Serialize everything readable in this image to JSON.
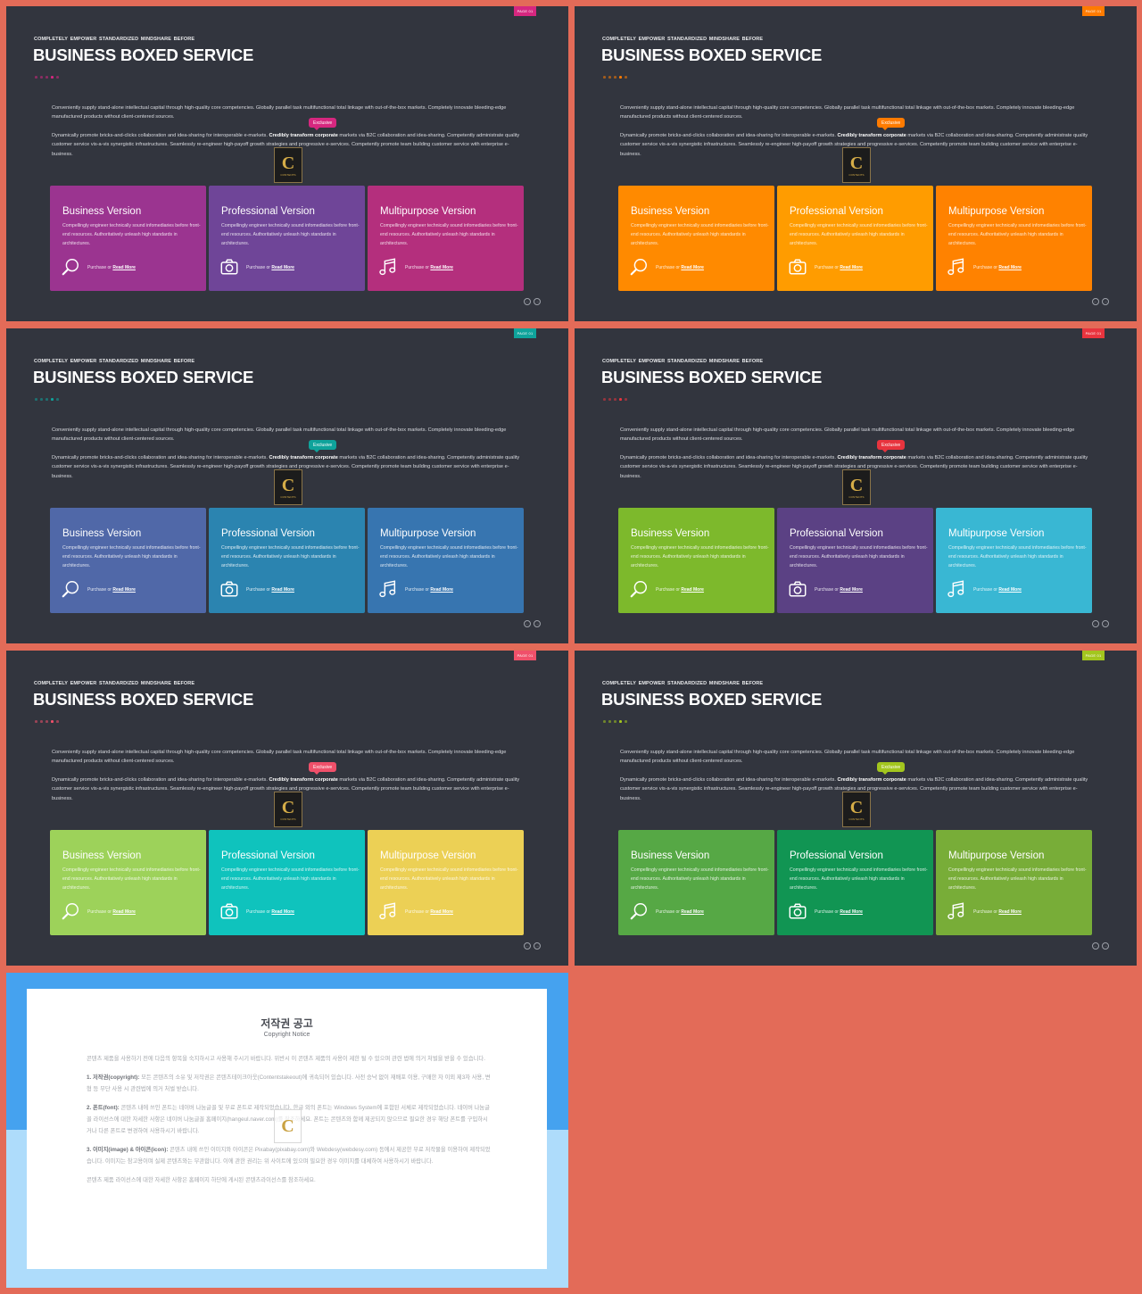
{
  "common": {
    "page_label": "PAGE 01",
    "kicker": "COMPLETELY  EMPOWER  STANDARDIZED  MINDSHARE  BEFORE",
    "title": "BUSINESS BOXED SERVICE",
    "para1": "Conveniently supply stand-alone intellectual capital through high-quality core competencies.  Globally parallel task multifunctional total linkage with out-of-the-box markets.  Completely innovate bleeding-edge manufactured products without client-centered sources.",
    "para2_before": "Dynamically promote bricks-and-clicks collaboration and idea-sharing for interoperable e-markets. ",
    "para2_bold": "Credibly transform corporate",
    "para2_after": " markets via B2C collaboration and idea-sharing. Competently administrate quality customer service vis-a-vis synergistic infrastructures. Seamlessly re-engineer high-payoff growth  strategies and progressive e-services. Competently  promote team building customer service with enterprise e-business.",
    "exclusive_label": "Exclusive",
    "logo_letter": "C",
    "logo_text": "CONTENTS",
    "card_desc": "Compellingly engineer technically sound infomediaries before front-end resources. Authoritatively unleash high standards in architectures.",
    "purchase_text": "Purchase or ",
    "read_more": "Read More",
    "nav_prev": "←",
    "nav_next": "→"
  },
  "slides": [
    {
      "accent": "#d6277f",
      "dots": [
        "#d6277f",
        "#d6277f",
        "#d6277f",
        "#d6277f",
        "#d6277f"
      ],
      "active_dot": 3,
      "cards": [
        {
          "title": "Business Version",
          "icon": "search-icon",
          "color": "#9b3490"
        },
        {
          "title": "Professional Version",
          "icon": "camera-icon",
          "color": "#6f4598"
        },
        {
          "title": "Multipurpose Version",
          "icon": "music-icon",
          "color": "#b42f7d"
        }
      ]
    },
    {
      "accent": "#ff7b00",
      "dots": [
        "#ff7b00",
        "#ff7b00",
        "#ff7b00",
        "#ff7b00",
        "#ff7b00"
      ],
      "active_dot": 3,
      "cards": [
        {
          "title": "Business Version",
          "icon": "search-icon",
          "color": "#ff8a00"
        },
        {
          "title": "Professional Version",
          "icon": "camera-icon",
          "color": "#ff9c00"
        },
        {
          "title": "Multipurpose Version",
          "icon": "music-icon",
          "color": "#ff8200"
        }
      ]
    },
    {
      "accent": "#0fa39b",
      "dots": [
        "#0fa39b",
        "#0fa39b",
        "#0fa39b",
        "#0fa39b",
        "#0fa39b"
      ],
      "active_dot": 3,
      "cards": [
        {
          "title": "Business Version",
          "icon": "search-icon",
          "color": "#5068a8"
        },
        {
          "title": "Professional Version",
          "icon": "camera-icon",
          "color": "#2b84b0"
        },
        {
          "title": "Multipurpose Version",
          "icon": "music-icon",
          "color": "#3775b0"
        }
      ]
    },
    {
      "accent": "#e8343e",
      "dots": [
        "#e8343e",
        "#e8343e",
        "#e8343e",
        "#e8343e",
        "#e8343e"
      ],
      "active_dot": 3,
      "cards": [
        {
          "title": "Business Version",
          "icon": "search-icon",
          "color": "#7db92c"
        },
        {
          "title": "Professional Version",
          "icon": "camera-icon",
          "color": "#5b4184"
        },
        {
          "title": "Multipurpose Version",
          "icon": "music-icon",
          "color": "#39b7d3"
        }
      ]
    },
    {
      "accent": "#f0506a",
      "dots": [
        "#f0506a",
        "#f0506a",
        "#f0506a",
        "#f0506a",
        "#f0506a"
      ],
      "active_dot": 3,
      "cards": [
        {
          "title": "Business Version",
          "icon": "search-icon",
          "color": "#9dd25a"
        },
        {
          "title": "Professional Version",
          "icon": "camera-icon",
          "color": "#0fc3bd"
        },
        {
          "title": "Multipurpose Version",
          "icon": "music-icon",
          "color": "#ecd055"
        }
      ]
    },
    {
      "accent": "#a3c61e",
      "dots": [
        "#a3c61e",
        "#a3c61e",
        "#a3c61e",
        "#a3c61e",
        "#a3c61e"
      ],
      "active_dot": 3,
      "cards": [
        {
          "title": "Business Version",
          "icon": "search-icon",
          "color": "#56a845"
        },
        {
          "title": "Professional Version",
          "icon": "camera-icon",
          "color": "#119553"
        },
        {
          "title": "Multipurpose Version",
          "icon": "music-icon",
          "color": "#78ad38"
        }
      ]
    }
  ],
  "copyright": {
    "title": "저작권 공고",
    "subtitle": "Copyright Notice",
    "intro": "콘텐츠 제품을 사용하기 전에 다음의 항목을 숙지하시고 사용해 주시기 바랍니다. 위반시 이 콘텐츠 제품의 사용이 제한 될 수 있으며 관련 법에 의거 처벌을 받을 수 있습니다.",
    "item1_head": "1. 저작권(copyright):",
    "item1_body": " 모든 콘텐츠의 소유 및 저작권은 콘텐츠테이크아웃(Contentstakeout)에 귀속되어 있습니다. 사전 승낙 없이 재배포 이용, 구매한 자 이외 제3자 사용, 변형 등 무단 사용 시 관련법에 의거 처벌 받습니다.",
    "item2_head": "2. 폰트(font):",
    "item2_body": " 콘텐츠 내에 쓰인 폰트는 네이버 나눔글꼴 및 무료 폰트로 제작되었습니다. 한글 외의 폰트는 Windows System에 포함된 서체로 제작되었습니다. 네이버 나눔글꼴 라이선스에 대한 자세한 사항은 네이버 나눔글꼴 홈페이지(hangeul.naver.com)를 참조하세요. 폰트는 콘텐츠와 함께 제공되지 않으므로 필요한 경우 해당 폰트를 구입하시거나 다른 폰트로 변경하여 사용하시기 바랍니다.",
    "item3_head": "3. 이미지(image) & 아이콘(icon):",
    "item3_body": " 콘텐츠 내에 쓰인 이미지와 아이콘은 Pixabay(pixabay.com)와 Webdesy(webdesy.com) 등에서 제공한 무료 저작물을 이용하여 제작되었습니다. 이미지는 참고용이며 실제 콘텐츠와는 무관합니다. 이에 관한 권리는 위 사이트에 있으며 필요한 경우 이미지를 대체하여 사용하시기 바랍니다.",
    "outro": "콘텐츠 제품 라이선스에 대한 자세한 사항은 홈페이지 하단에 게시된 콘텐츠라이선스를 참조하세요.",
    "logo_letter": "C"
  }
}
